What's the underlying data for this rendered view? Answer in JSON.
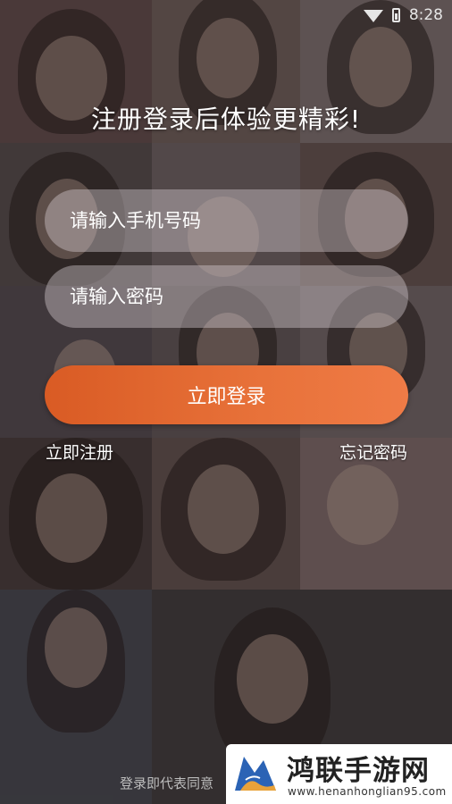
{
  "status_bar": {
    "time": "8:28",
    "icons": [
      "wifi-icon",
      "battery-icon"
    ]
  },
  "headline": "注册登录后体验更精彩!",
  "login_form": {
    "phone_placeholder": "请输入手机号码",
    "password_placeholder": "请输入密码",
    "login_button_label": "立即登录"
  },
  "links": {
    "register": "立即注册",
    "forgot_password": "忘记密码"
  },
  "terms_text": "登录即代表同意",
  "watermark": {
    "title": "鸿联手游网",
    "url": "www.henanhonglian95.com"
  },
  "colors": {
    "accent": "#e8723a",
    "field_bg": "#d7cdd2",
    "text": "#ffffff"
  }
}
